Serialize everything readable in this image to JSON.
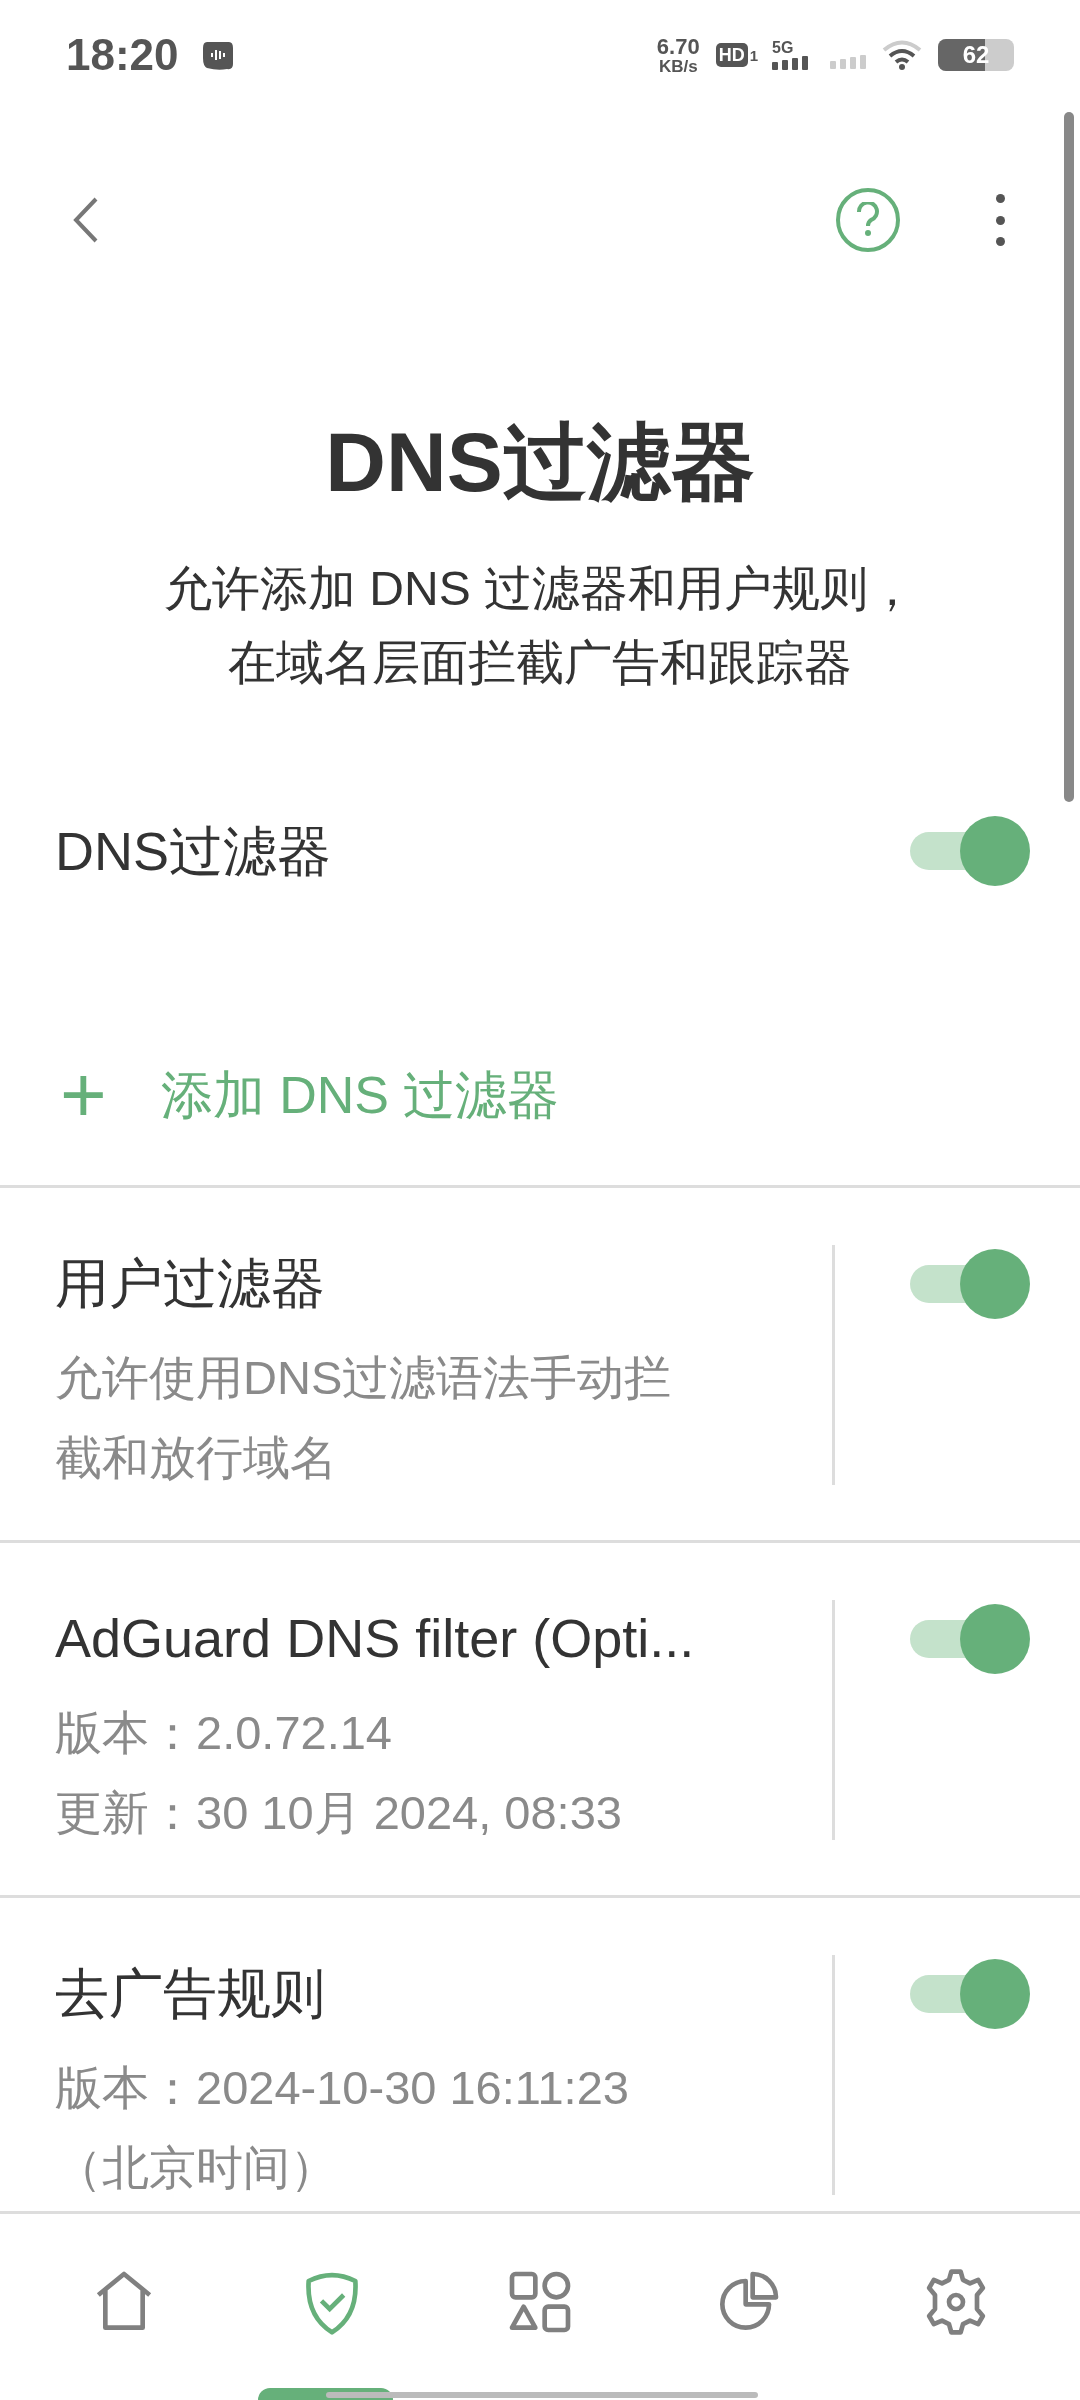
{
  "status_bar": {
    "time": "18:20",
    "speed_value": "6.70",
    "speed_unit": "KB/s",
    "hd": "HD",
    "hd_sim": "1",
    "network": "5G",
    "battery": "62"
  },
  "title": "DNS过滤器",
  "subtitle_lines": [
    "允许添加 DNS 过滤器和用户规则，",
    "在域名层面拦截广告和跟踪器"
  ],
  "main_toggle": {
    "label": "DNS过滤器",
    "on": true
  },
  "add_button": {
    "icon": "+",
    "label": "添加 DNS 过滤器"
  },
  "filters": [
    {
      "title": "用户过滤器",
      "lines": [
        "允许使用DNS过滤语法手动拦",
        "截和放行域名"
      ],
      "on": true
    },
    {
      "title": "AdGuard DNS filter (Opti...",
      "lines": [
        "版本：2.0.72.14",
        "更新：30 10月 2024, 08:33"
      ],
      "on": true
    },
    {
      "title": "去广告规则",
      "lines": [
        "版本：2024-10-30 16:11:23",
        "（北京时间）"
      ],
      "on": true
    }
  ],
  "nav": [
    {
      "kind": "home",
      "selected": false
    },
    {
      "kind": "shield",
      "selected": true
    },
    {
      "kind": "apps",
      "selected": false
    },
    {
      "kind": "stats",
      "selected": false
    },
    {
      "kind": "settings",
      "selected": false
    }
  ]
}
